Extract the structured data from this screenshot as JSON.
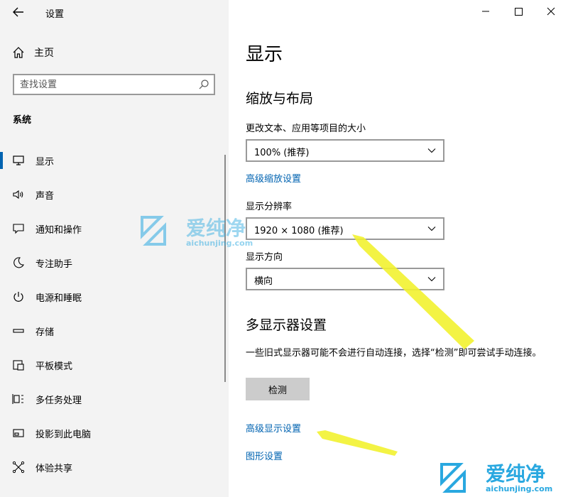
{
  "window": {
    "title": "设置",
    "back_icon": "arrow-left-icon",
    "controls": [
      "minimize-icon",
      "maximize-icon",
      "close-icon"
    ]
  },
  "sidebar": {
    "home_label": "主页",
    "search_placeholder": "查找设置",
    "section_title": "系统",
    "items": [
      {
        "label": "显示",
        "icon": "monitor-icon",
        "active": true
      },
      {
        "label": "声音",
        "icon": "speaker-icon"
      },
      {
        "label": "通知和操作",
        "icon": "notification-icon"
      },
      {
        "label": "专注助手",
        "icon": "moon-icon"
      },
      {
        "label": "电源和睡眠",
        "icon": "power-icon"
      },
      {
        "label": "存储",
        "icon": "storage-icon"
      },
      {
        "label": "平板模式",
        "icon": "tablet-icon"
      },
      {
        "label": "多任务处理",
        "icon": "multitask-icon"
      },
      {
        "label": "投影到此电脑",
        "icon": "project-icon"
      },
      {
        "label": "体验共享",
        "icon": "share-icon"
      }
    ]
  },
  "main": {
    "title": "显示",
    "scale_section": {
      "heading": "缩放与布局",
      "text_size_label": "更改文本、应用等项目的大小",
      "text_size_value": "100% (推荐)",
      "advanced_scaling_link": "高级缩放设置",
      "resolution_label": "显示分辨率",
      "resolution_value": "1920 × 1080 (推荐)",
      "orientation_label": "显示方向",
      "orientation_value": "横向"
    },
    "multi_display": {
      "heading": "多显示器设置",
      "description": "一些旧式显示器可能不会进行自动连接，选择“检测”即可尝试手动连接。",
      "detect_button": "检测",
      "advanced_display_link": "高级显示设置",
      "graphics_link": "图形设置"
    }
  },
  "watermark": {
    "brand": "爱纯净",
    "url": "aichunjing.com",
    "accent": "#29a8e0"
  },
  "annotation": {
    "arrow_color": "#f2f230"
  }
}
